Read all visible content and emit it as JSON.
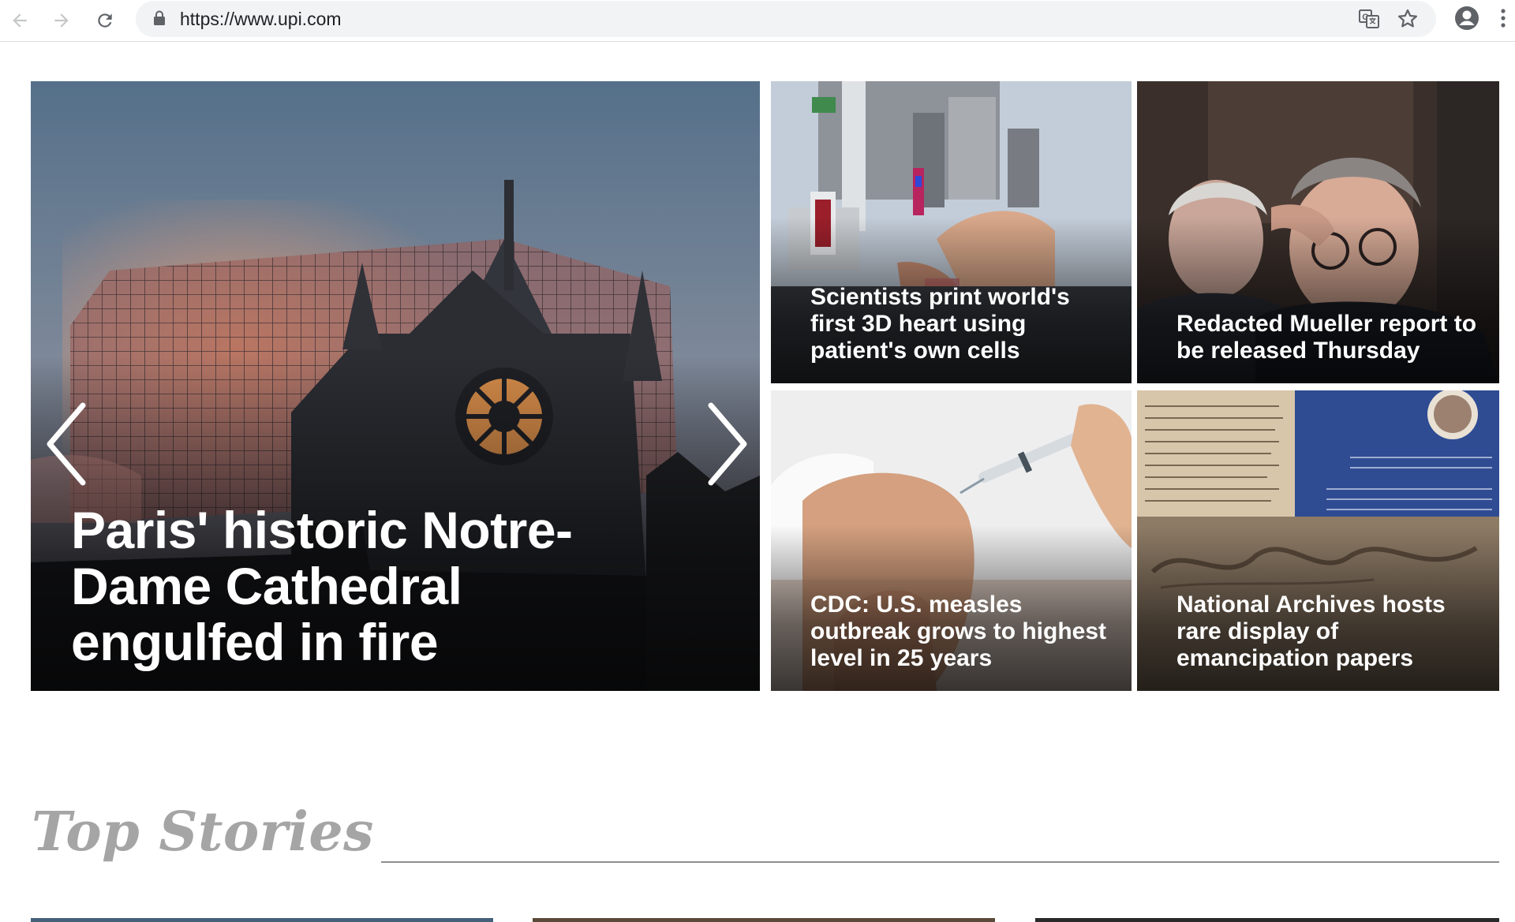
{
  "browser": {
    "url": "https://www.upi.com",
    "icons": [
      "back-arrow-icon",
      "forward-arrow-icon",
      "reload-icon",
      "lock-icon",
      "translate-icon",
      "star-icon",
      "profile-icon",
      "kebab-menu-icon"
    ]
  },
  "hero": {
    "headline": "Paris' historic Notre-Dame Cathedral engulfed in fire",
    "icons": [
      "chevron-left-icon",
      "chevron-right-icon"
    ]
  },
  "tiles": [
    {
      "headline": "Scientists print world's first 3D heart using patient's own cells"
    },
    {
      "headline": "Redacted Mueller report to be released Thursday"
    },
    {
      "headline": "CDC: U.S. measles outbreak grows to highest level in 25 years"
    },
    {
      "headline": "National Archives hosts rare display of emancipation papers"
    }
  ],
  "section": {
    "title": "Top Stories"
  },
  "colors": {
    "section_title": "#a5a5a5",
    "rule": "#8f8f8f",
    "chrome_bg": "#f1f3f4"
  }
}
